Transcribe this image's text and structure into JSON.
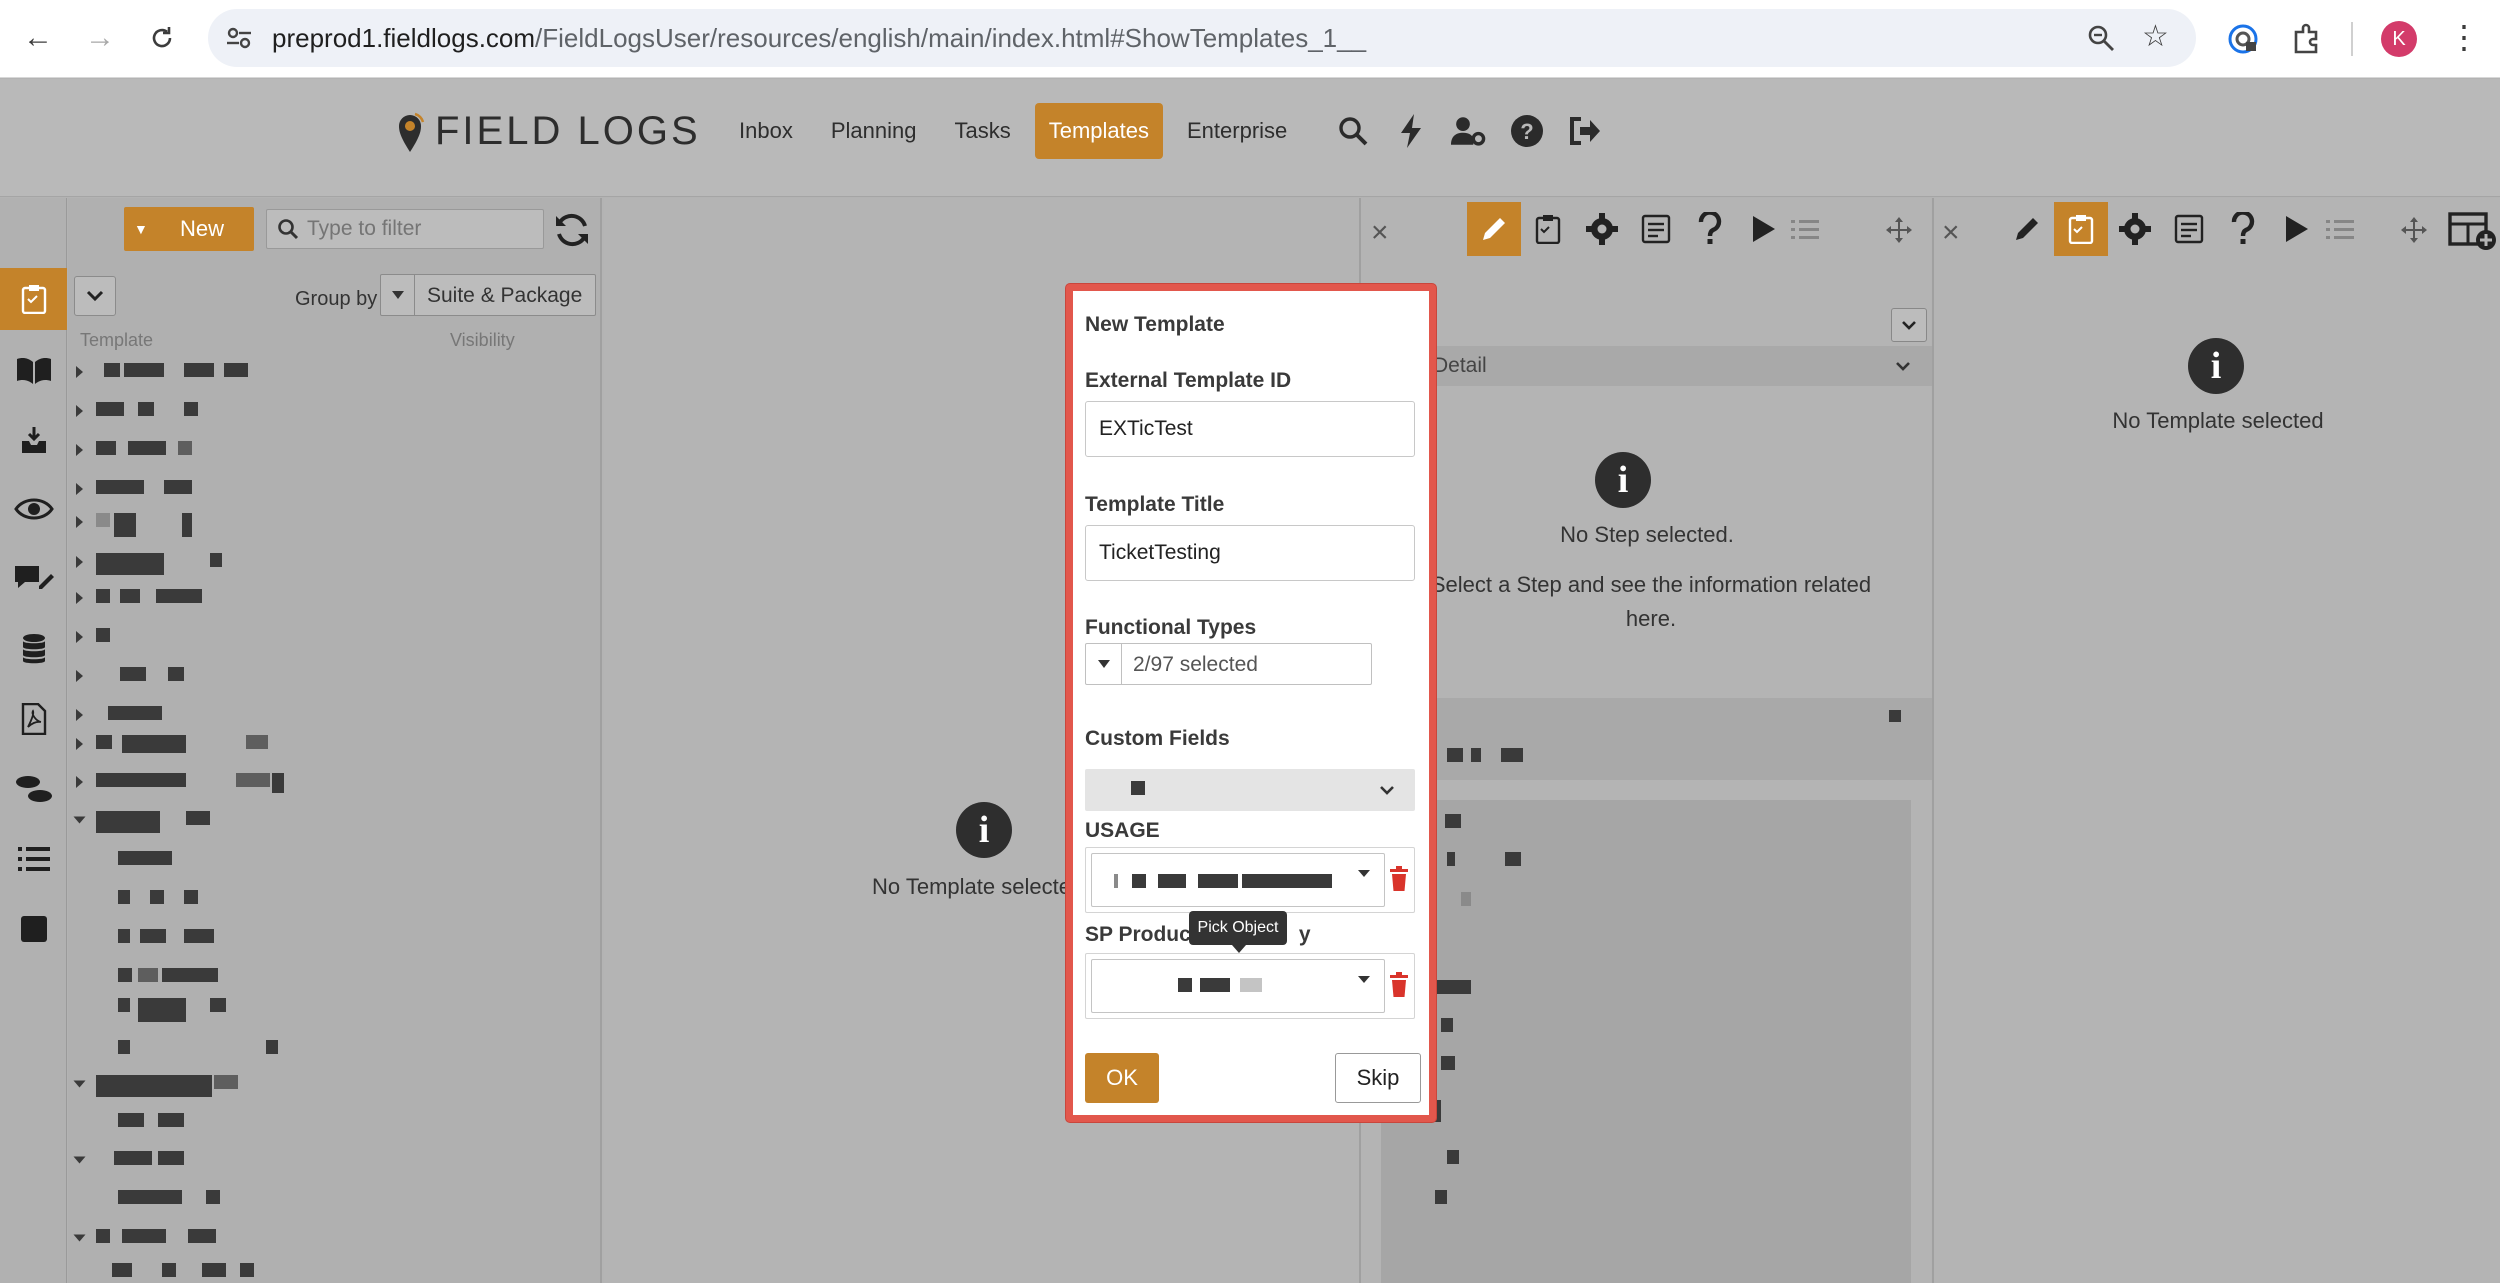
{
  "browser": {
    "url_host": "preprod1.fieldlogs.com",
    "url_path": "/FieldLogsUser/resources/english/main/index.html#ShowTemplates_1__",
    "avatar_letter": "K"
  },
  "app": {
    "logo_text": "FIELD LOGS",
    "nav": [
      "Inbox",
      "Planning",
      "Tasks",
      "Templates",
      "Enterprise"
    ],
    "active_nav": "Templates"
  },
  "list_panel": {
    "new_label": "New",
    "filter_placeholder": "Type to filter",
    "group_by_label": "Group by",
    "group_by_value": "Suite & Package",
    "col_template": "Template",
    "col_visibility": "Visibility"
  },
  "middle_panel": {
    "message": "No Template selected"
  },
  "step_panel": {
    "detail_label": "Detail",
    "no_step": "No Step selected.",
    "hint": "Select a Step and see the information related here."
  },
  "right_panel": {
    "message": "No Template selected"
  },
  "modal": {
    "title": "New Template",
    "external_id_label": "External Template ID",
    "external_id_value": "EXTicTest",
    "title_label": "Template Title",
    "title_value": "TicketTesting",
    "functional_types_label": "Functional Types",
    "functional_types_value": "2/97 selected",
    "custom_fields_label": "Custom Fields",
    "usage_label": "USAGE",
    "sp_label": "SP Produc",
    "sp_label_tail": "y",
    "tooltip": "Pick Object",
    "ok_label": "OK",
    "skip_label": "Skip"
  },
  "colors": {
    "accent": "#c4832a",
    "modal_border": "#e2574c",
    "trash": "#d9342b"
  }
}
